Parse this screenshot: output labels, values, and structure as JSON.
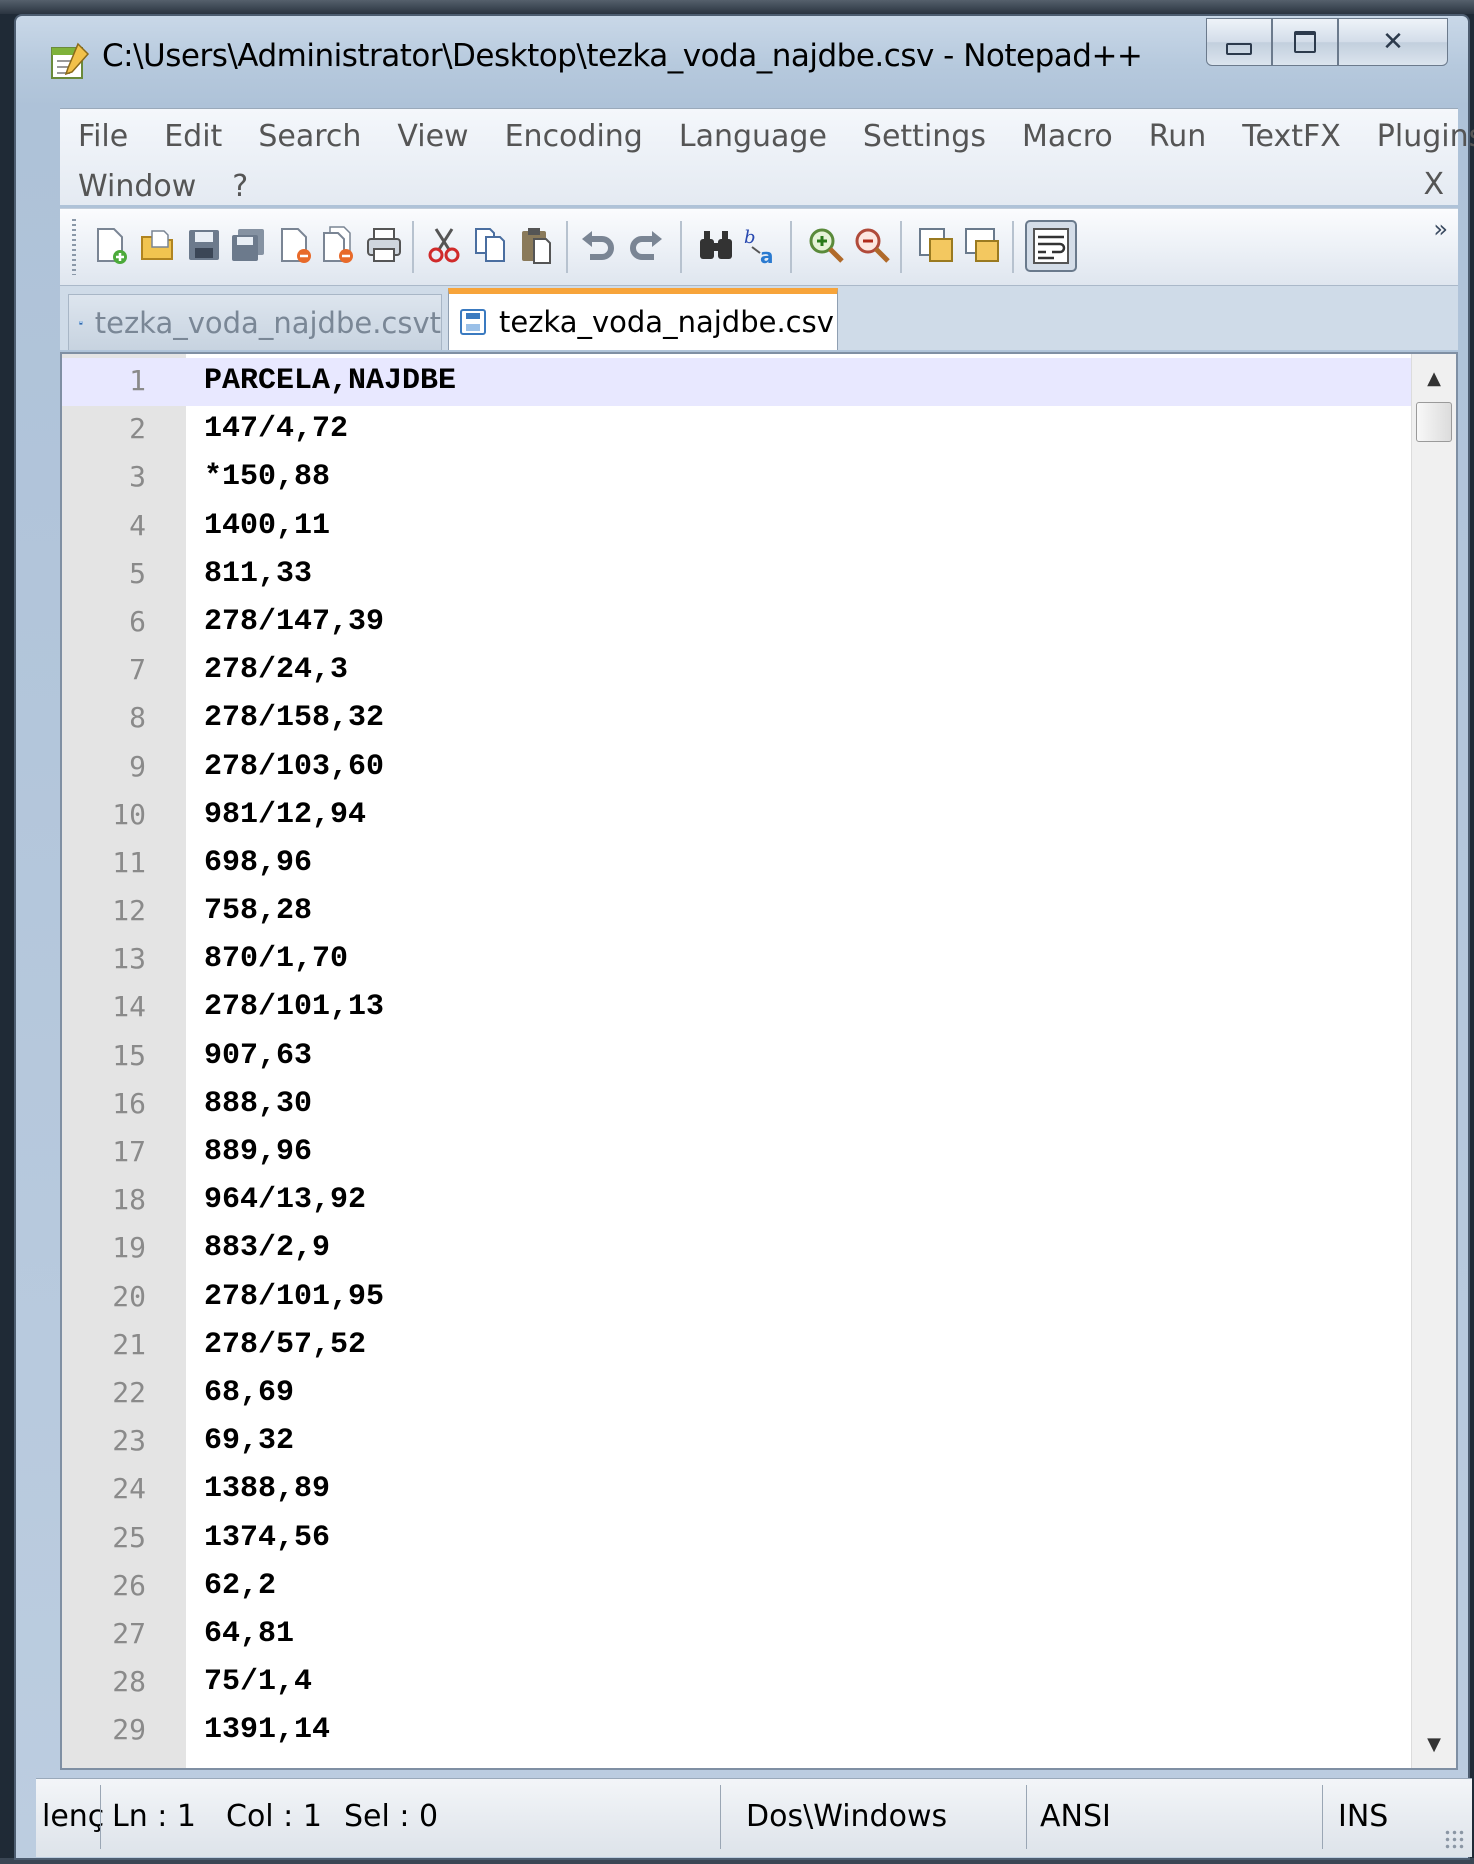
{
  "window": {
    "title": "C:\\Users\\Administrator\\Desktop\\tezka_voda_najdbe.csv - Notepad++",
    "minimize": "▭",
    "maximize": "▣",
    "close": "✕"
  },
  "menu": {
    "row1": [
      "File",
      "Edit",
      "Search",
      "View",
      "Encoding",
      "Language",
      "Settings",
      "Macro",
      "Run",
      "TextFX",
      "Plugins"
    ],
    "row2": [
      "Window",
      "?"
    ],
    "close": "X"
  },
  "toolbar": {
    "icons": [
      "new-file-icon",
      "open-file-icon",
      "save-icon",
      "save-all-icon",
      "close-icon",
      "close-all-icon",
      "print-icon",
      "cut-icon",
      "copy-icon",
      "paste-icon",
      "undo-icon",
      "redo-icon",
      "find-icon",
      "replace-icon",
      "zoom-in-icon",
      "zoom-out-icon",
      "sync-vertical-icon",
      "sync-horizontal-icon",
      "word-wrap-icon"
    ],
    "overflow": "»"
  },
  "tabs": [
    {
      "label": "tezka_voda_najdbe.csvt",
      "active": false
    },
    {
      "label": "tezka_voda_najdbe.csv",
      "active": true
    }
  ],
  "editor": {
    "lines": [
      {
        "n": "1",
        "text": "PARCELA,NAJDBE"
      },
      {
        "n": "2",
        "text": "147/4,72"
      },
      {
        "n": "3",
        "text": "*150,88"
      },
      {
        "n": "4",
        "text": "1400,11"
      },
      {
        "n": "5",
        "text": "811,33"
      },
      {
        "n": "6",
        "text": "278/147,39"
      },
      {
        "n": "7",
        "text": "278/24,3"
      },
      {
        "n": "8",
        "text": "278/158,32"
      },
      {
        "n": "9",
        "text": "278/103,60"
      },
      {
        "n": "10",
        "text": "981/12,94"
      },
      {
        "n": "11",
        "text": "698,96"
      },
      {
        "n": "12",
        "text": "758,28"
      },
      {
        "n": "13",
        "text": "870/1,70"
      },
      {
        "n": "14",
        "text": "278/101,13"
      },
      {
        "n": "15",
        "text": "907,63"
      },
      {
        "n": "16",
        "text": "888,30"
      },
      {
        "n": "17",
        "text": "889,96"
      },
      {
        "n": "18",
        "text": "964/13,92"
      },
      {
        "n": "19",
        "text": "883/2,9"
      },
      {
        "n": "20",
        "text": "278/101,95"
      },
      {
        "n": "21",
        "text": "278/57,52"
      },
      {
        "n": "22",
        "text": "68,69"
      },
      {
        "n": "23",
        "text": "69,32"
      },
      {
        "n": "24",
        "text": "1388,89"
      },
      {
        "n": "25",
        "text": "1374,56"
      },
      {
        "n": "26",
        "text": "62,2"
      },
      {
        "n": "27",
        "text": "64,81"
      },
      {
        "n": "28",
        "text": "75/1,4"
      },
      {
        "n": "29",
        "text": "1391,14"
      }
    ],
    "current_line": 1
  },
  "status": {
    "length": "lenç",
    "ln": "Ln : 1",
    "col": "Col : 1",
    "sel": "Sel : 0",
    "eol": "Dos\\Windows",
    "encoding": "ANSI",
    "mode": "INS"
  },
  "colors": {
    "active_tab_accent": "#f7a43a",
    "current_line_bg": "#e8e8ff",
    "gutter_bg": "#e4e4e4"
  }
}
